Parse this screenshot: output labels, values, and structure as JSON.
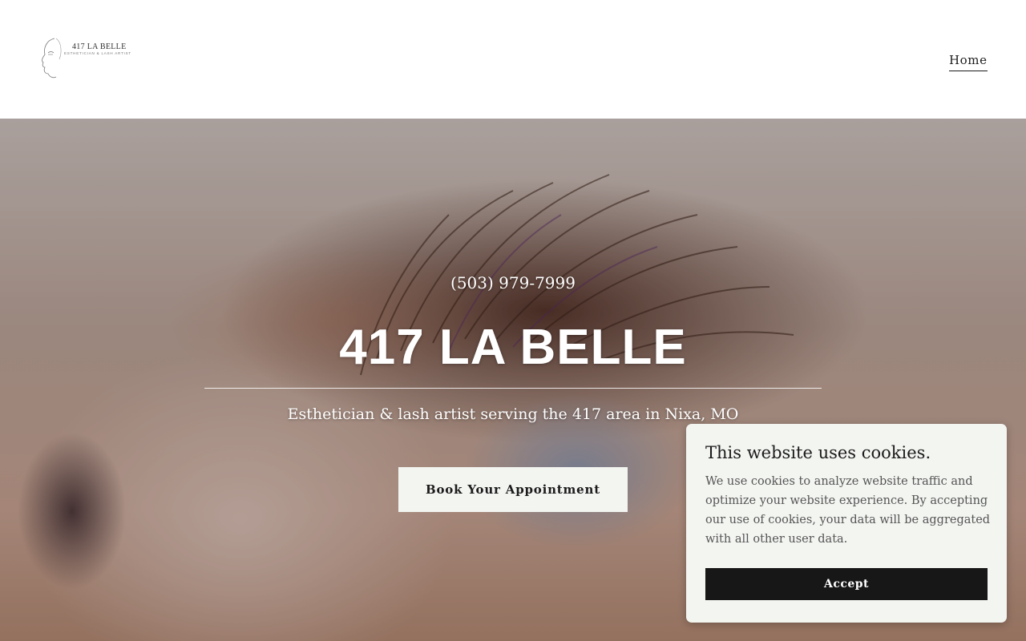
{
  "header": {
    "logo_text": "417 LA BELLE",
    "logo_subtext": "ESTHETICIAN & LASH ARTIST",
    "nav_home": "Home"
  },
  "hero": {
    "phone": "(503) 979-7999",
    "title": "417 LA BELLE",
    "tagline": "Esthetician & lash artist serving the 417 area in Nixa, MO",
    "cta_label": "Book Your Appointment"
  },
  "cookie_banner": {
    "title": "This website uses cookies.",
    "body": "We use cookies to analyze website traffic and optimize your website experience. By accepting our use of cookies, your data will be aggregated with all other user data.",
    "accept_label": "Accept"
  },
  "colors": {
    "button_bg": "#f3f5f1",
    "accept_bg": "#171717",
    "text_dark": "#1b1b1b"
  }
}
